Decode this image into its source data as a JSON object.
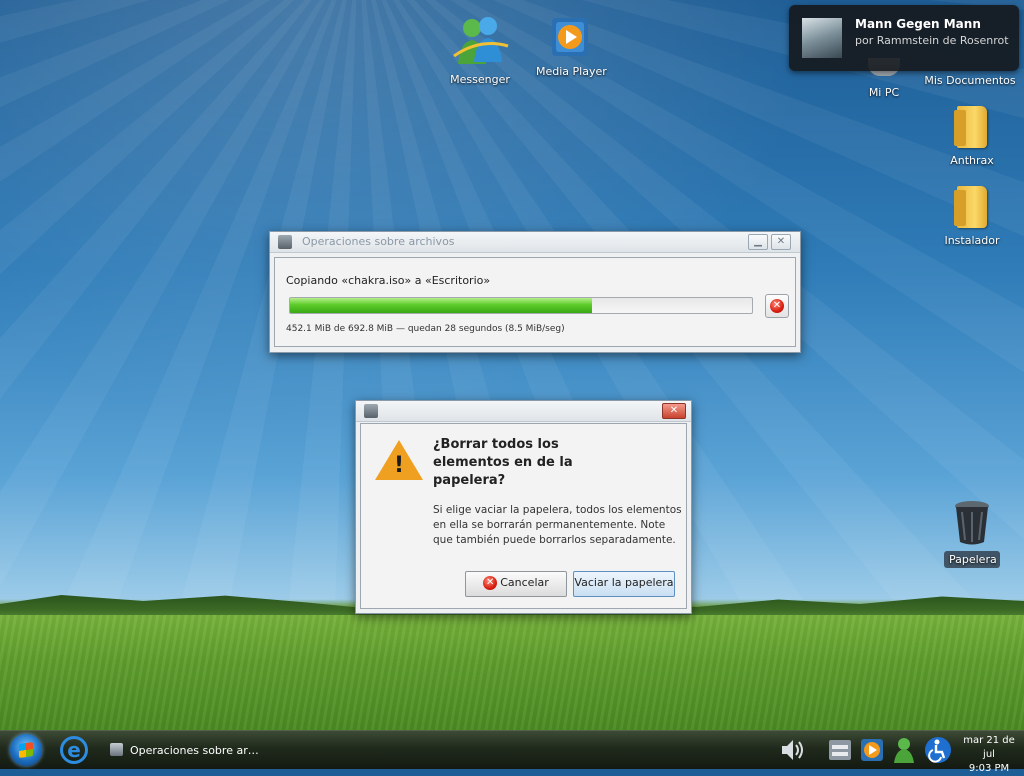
{
  "desktop": {
    "icons": {
      "messenger": "Messenger",
      "media_player": "Media Player",
      "mi_pc": "Mi PC",
      "mis_documentos": "Mis Documentos",
      "anthrax": "Anthrax",
      "instalador": "Instalador",
      "papelera": "Papelera"
    }
  },
  "notification": {
    "title": "Mann Gegen Mann",
    "subtitle": "por Rammstein de Rosenrot"
  },
  "copy_window": {
    "title": "Operaciones sobre archivos",
    "status": "Copiando «chakra.iso» a «Escritorio»",
    "progress_fraction": 0.653,
    "detail": "452.1 MiB de 692.8 MiB — quedan 28 segundos (8.5 MiB/seg)"
  },
  "trash_dialog": {
    "heading": "¿Borrar todos los elementos en de la papelera?",
    "body": "Si elige vaciar la papelera, todos los elementos en ella se borrarán permanentemente. Note que también puede borrarlos separadamente.",
    "cancel_label": "Cancelar",
    "confirm_label": "Vaciar la papelera"
  },
  "taskbar": {
    "task_label": "Operaciones sobre ar…",
    "clock_date": "mar 21 de jul",
    "clock_time": "9:03 PM"
  },
  "colors": {
    "progress_green": "#5dcc2a",
    "warning_orange": "#f0a020",
    "close_red": "#d81f10"
  }
}
